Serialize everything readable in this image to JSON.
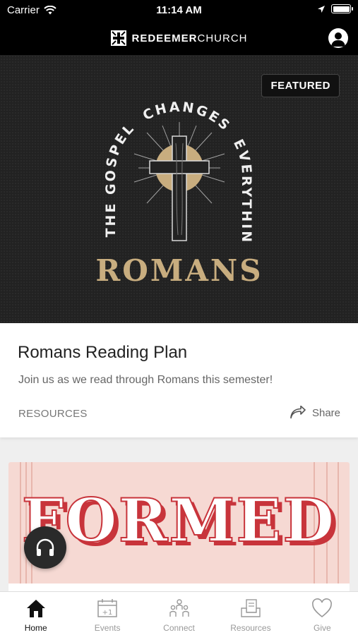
{
  "status_bar": {
    "carrier": "Carrier",
    "time": "11:14 AM"
  },
  "header": {
    "brand_bold": "REDEEMER",
    "brand_light": "CHURCH"
  },
  "featured": {
    "badge": "FEATURED",
    "art_arc_left": "THE GOSPEL",
    "art_arc_top": "CHANGES",
    "art_arc_right": "EVERYTHING",
    "art_title": "ROMANS",
    "title": "Romans Reading Plan",
    "description": "Join us as we read through Romans this semester!",
    "category": "RESOURCES",
    "share_label": "Share"
  },
  "second_card": {
    "art_title": "FORMED"
  },
  "tabs": [
    {
      "label": "Home",
      "icon": "home-icon",
      "active": true
    },
    {
      "label": "Events",
      "icon": "calendar-plus-icon",
      "active": false
    },
    {
      "label": "Connect",
      "icon": "people-icon",
      "active": false
    },
    {
      "label": "Resources",
      "icon": "resources-icon",
      "active": false
    },
    {
      "label": "Give",
      "icon": "heart-icon",
      "active": false
    }
  ],
  "colors": {
    "accent_gold": "#c8ad7f",
    "formed_red": "#c8343b",
    "formed_bg": "#f6d9d3"
  }
}
